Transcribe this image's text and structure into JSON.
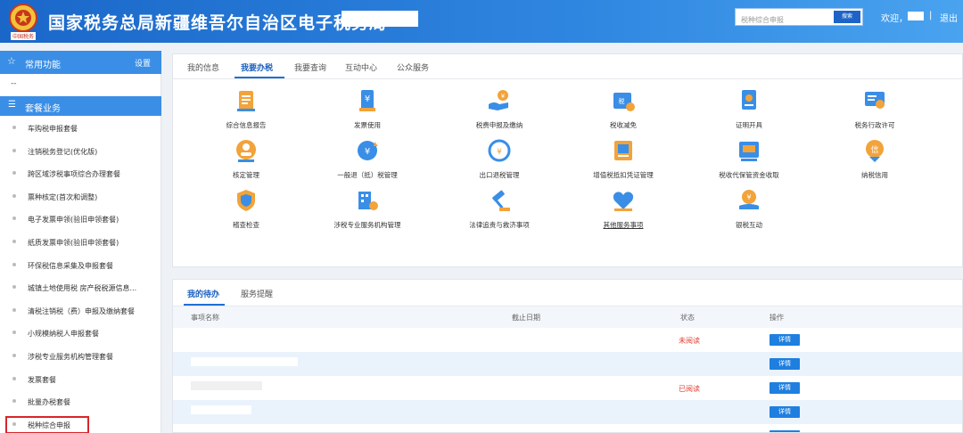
{
  "header": {
    "title": "国家税务总局新疆维吾尔自治区电子税务局",
    "search_placeholder": "税种综合申报",
    "search_button": "搜索",
    "welcome": "欢迎，",
    "separator": "|",
    "logout": "退出",
    "logo_text": "中国税务"
  },
  "sidebar": {
    "common_label": "常用功能",
    "settings_label": "设置",
    "empty_text": "--",
    "category_label": "套餐业务",
    "items": [
      {
        "label": "车购税申报套餐"
      },
      {
        "label": "注销税务登记(优化版)"
      },
      {
        "label": "跨区域涉税事项综合办理套餐"
      },
      {
        "label": "票种核定(首次和调整)"
      },
      {
        "label": "电子发票申领(验旧申领套餐)"
      },
      {
        "label": "纸质发票申领(验旧申领套餐)"
      },
      {
        "label": "环保税信息采集及申报套餐"
      },
      {
        "label": "城镇土地使用税 房产税税源信息..."
      },
      {
        "label": "清税注销税（费）申报及缴纳套餐"
      },
      {
        "label": "小规模纳税人申报套餐"
      },
      {
        "label": "涉税专业服务机构管理套餐"
      },
      {
        "label": "发票套餐"
      },
      {
        "label": "批量办税套餐"
      },
      {
        "label": "税种综合申报"
      }
    ]
  },
  "main": {
    "tabs": [
      {
        "label": "我的信息"
      },
      {
        "label": "我要办税"
      },
      {
        "label": "我要查询"
      },
      {
        "label": "互动中心"
      },
      {
        "label": "公众服务"
      }
    ],
    "services": [
      {
        "label": "综合信息报告",
        "icon": "report-icon"
      },
      {
        "label": "发票使用",
        "icon": "invoice-icon"
      },
      {
        "label": "税费申报及缴纳",
        "icon": "tax-payment-icon"
      },
      {
        "label": "税收减免",
        "icon": "tax-relief-icon"
      },
      {
        "label": "证明开具",
        "icon": "certificate-icon"
      },
      {
        "label": "税务行政许可",
        "icon": "admin-permit-icon"
      },
      {
        "label": "核定管理",
        "icon": "assessment-icon"
      },
      {
        "label": "一般退（抵）税管理",
        "icon": "refund-icon"
      },
      {
        "label": "出口退税管理",
        "icon": "export-refund-icon"
      },
      {
        "label": "增值税抵扣凭证管理",
        "icon": "vat-voucher-icon"
      },
      {
        "label": "税收代保管资金收取",
        "icon": "custody-fund-icon"
      },
      {
        "label": "纳税信用",
        "icon": "credit-icon"
      },
      {
        "label": "稽查检查",
        "icon": "inspection-icon"
      },
      {
        "label": "涉税专业服务机构管理",
        "icon": "agency-icon"
      },
      {
        "label": "法律追责与救济事项",
        "icon": "legal-icon"
      },
      {
        "label": "其他服务事项",
        "icon": "other-services-icon"
      },
      {
        "label": "银税互动",
        "icon": "bank-tax-icon"
      }
    ]
  },
  "todo": {
    "tabs": [
      {
        "label": "我的待办"
      },
      {
        "label": "服务提醒"
      }
    ],
    "columns": [
      "事项名称",
      "截止日期",
      "状态",
      "操作"
    ],
    "rows": [
      {
        "status": "未阅读",
        "action": "详情"
      },
      {
        "status": "",
        "action": "详情"
      },
      {
        "status": "已阅读",
        "action": "详情"
      },
      {
        "status": "",
        "action": "详情"
      },
      {
        "status": "",
        "action": "详情"
      }
    ]
  },
  "colors": {
    "header_gradient_start": "#1a67c9",
    "accent": "#1e6fd6",
    "icon_orange": "#f2a33a",
    "icon_blue": "#3a8ee6",
    "status_red": "#e23b2f",
    "highlight_red": "#d8262a"
  }
}
